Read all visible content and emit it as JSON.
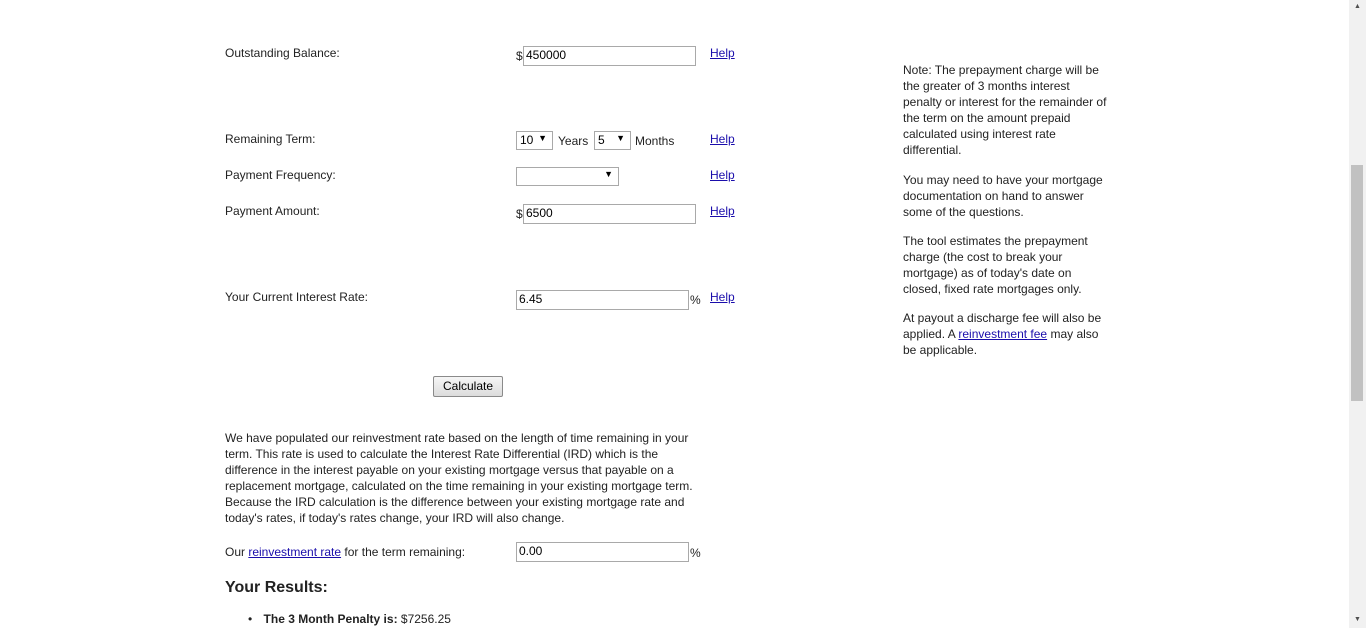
{
  "form": {
    "outstanding_balance": {
      "label": "Outstanding Balance:",
      "currency": "$",
      "value": "450000",
      "help": "Help"
    },
    "remaining_term": {
      "label": "Remaining Term:",
      "years_value": "10",
      "years_label": "Years",
      "months_value": "5",
      "months_label": "Months",
      "help": "Help"
    },
    "payment_frequency": {
      "label": "Payment Frequency:",
      "value": "",
      "help": "Help"
    },
    "payment_amount": {
      "label": "Payment Amount:",
      "currency": "$",
      "value": "6500",
      "help": "Help"
    },
    "interest_rate": {
      "label": "Your Current Interest Rate:",
      "value": "6.45",
      "unit": "%",
      "help": "Help"
    },
    "calculate_label": "Calculate"
  },
  "explanation": "We have populated our reinvestment rate based on the length of time remaining in your term. This rate is used to calculate the Interest Rate Differential (IRD) which is the difference in the interest payable on your existing mortgage versus that payable on a replacement mortgage, calculated on the time remaining in your existing mortgage term. Because the IRD calculation is the difference between your existing mortgage rate and today's rates, if today's rates change, your IRD will also change.",
  "reinvestment": {
    "prefix": "Our ",
    "link": "reinvestment rate",
    "suffix": " for the term remaining:",
    "value": "0.00",
    "unit": "%"
  },
  "results": {
    "heading": "Your Results:",
    "items": [
      {
        "label": "The 3 Month Penalty is:",
        "value": " $7256.25"
      }
    ]
  },
  "sidebar": {
    "note1": "Note: The prepayment charge will be the greater of 3 months interest penalty or interest for the remainder of the term on the amount prepaid calculated using interest rate differential.",
    "note2": "You may need to have your mortgage documentation on hand to answer some of the questions.",
    "note3": "The tool estimates the prepayment charge (the cost to break your mortgage) as of today's date on closed, fixed rate mortgages only.",
    "note4_prefix": "At payout a discharge fee will also be applied. A ",
    "note4_link": "reinvestment fee",
    "note4_suffix": " may also be applicable."
  }
}
